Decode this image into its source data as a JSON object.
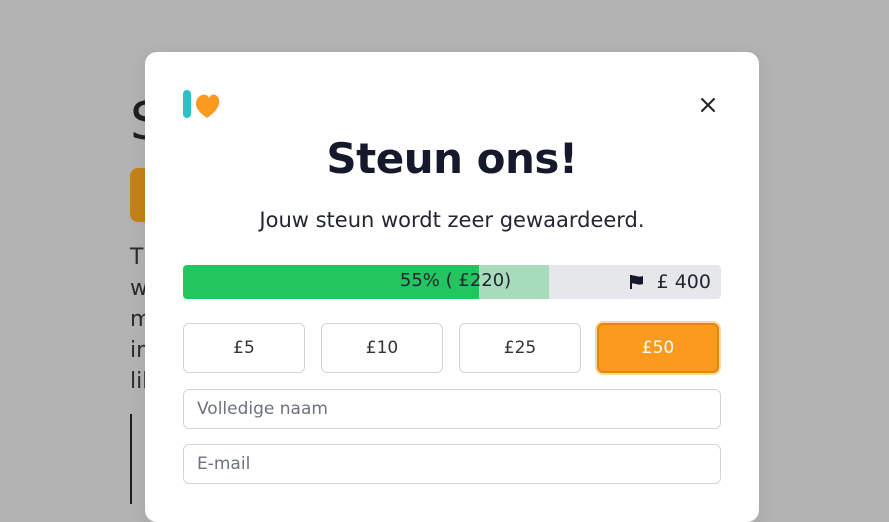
{
  "modal": {
    "title": "Steun ons!",
    "subtitle": "Jouw steun wordt zeer gewaardeerd.",
    "close_icon": "close-icon",
    "logo_icon": "kofi-logo-icon"
  },
  "progress": {
    "percent": 55,
    "pending_percent": 68,
    "label": "55% ( £220)",
    "goal_icon": "flag-icon",
    "goal": "£ 400",
    "fill_color": "#22c55e",
    "pending_color": "#a7dcba"
  },
  "amounts": [
    {
      "label": "£5",
      "selected": false
    },
    {
      "label": "£10",
      "selected": false
    },
    {
      "label": "£25",
      "selected": false
    },
    {
      "label": "£50",
      "selected": true
    }
  ],
  "form": {
    "name_placeholder": "Volledige naam",
    "email_placeholder": "E-mail"
  },
  "colors": {
    "accent": "#fb9a1e",
    "brand_teal": "#29abe0"
  }
}
